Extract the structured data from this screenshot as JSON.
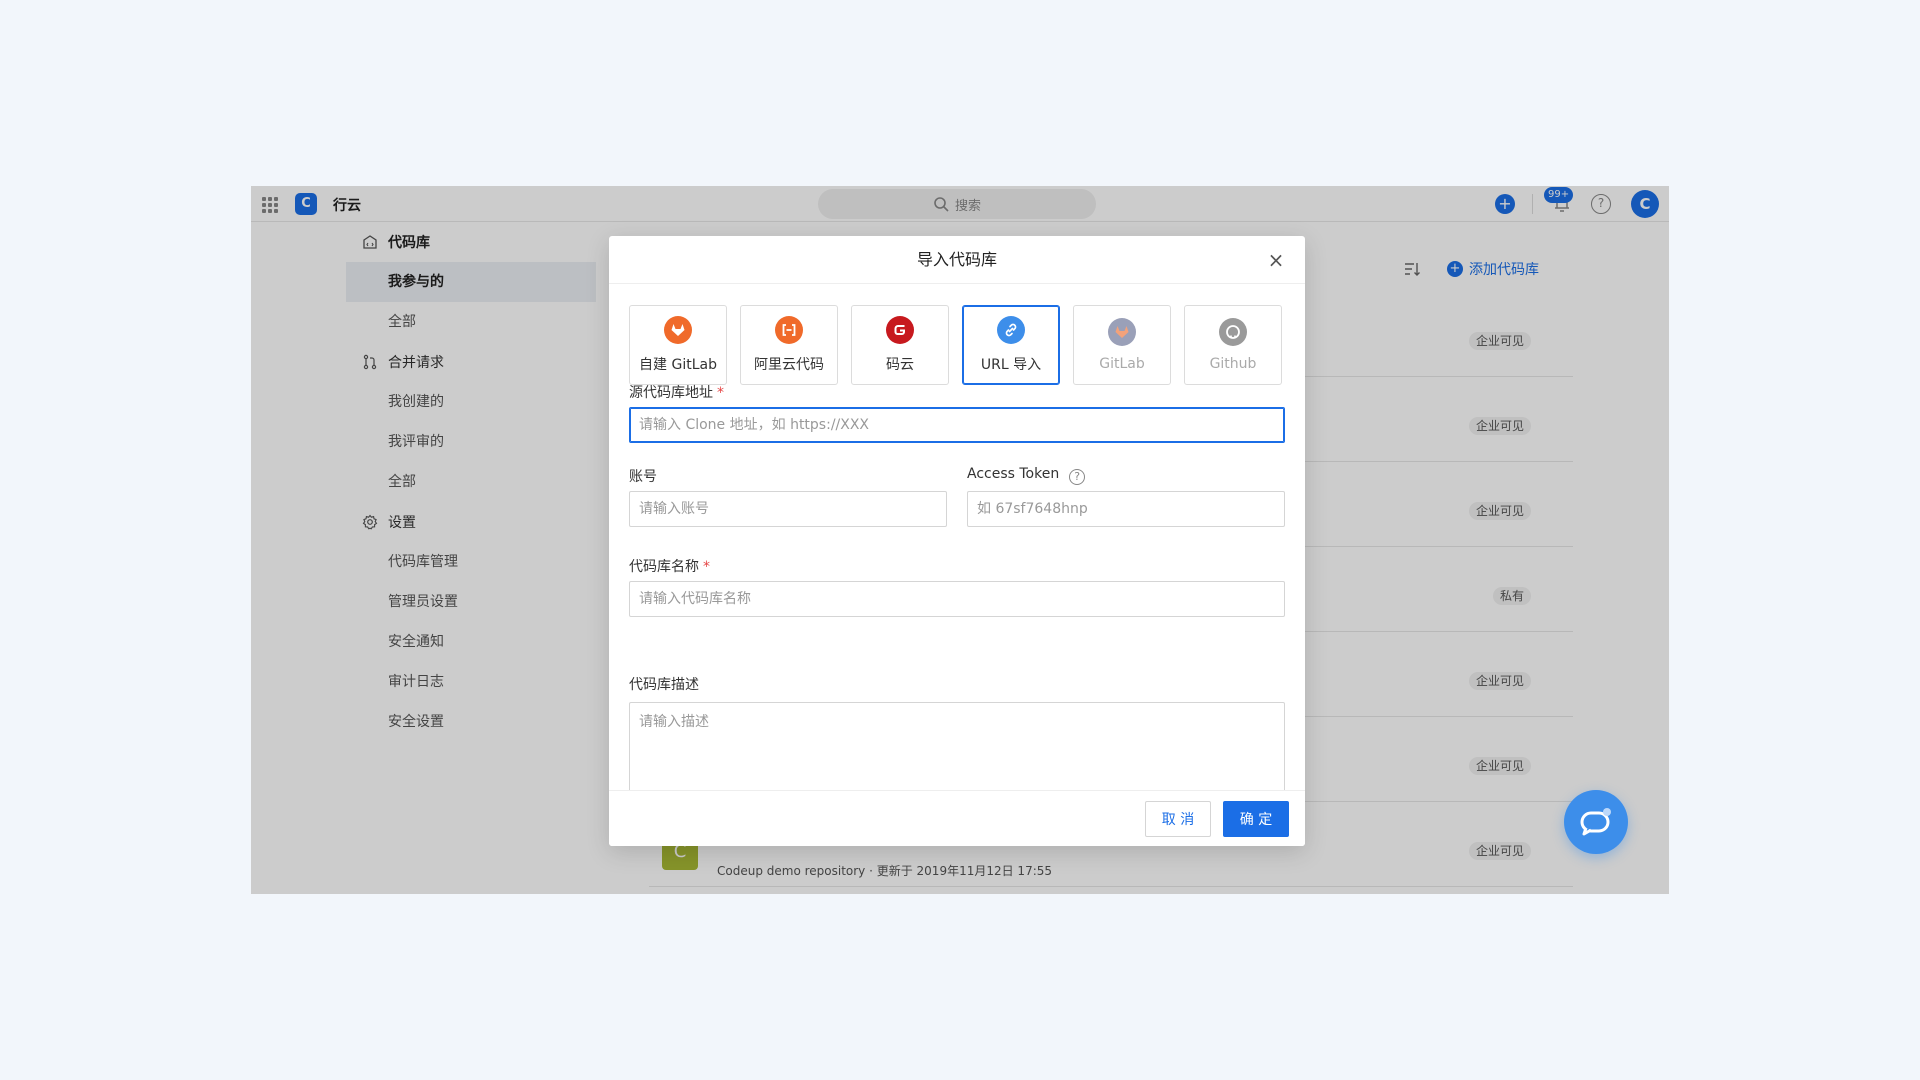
{
  "app": {
    "name": "行云",
    "logo_letter": "C",
    "avatar_letter": "C"
  },
  "search": {
    "placeholder": "搜索"
  },
  "notifications": {
    "count": "99+"
  },
  "sidebar": {
    "groups": [
      {
        "label": "代码库",
        "icon": "repo-icon",
        "items": [
          {
            "label": "我参与的",
            "active": true
          },
          {
            "label": "全部"
          }
        ]
      },
      {
        "label": "合并请求",
        "icon": "merge-request-icon",
        "items": [
          {
            "label": "我创建的"
          },
          {
            "label": "我评审的"
          },
          {
            "label": "全部"
          }
        ]
      },
      {
        "label": "设置",
        "icon": "gear-icon",
        "items": [
          {
            "label": "代码库管理"
          },
          {
            "label": "管理员设置"
          },
          {
            "label": "安全通知"
          },
          {
            "label": "审计日志"
          },
          {
            "label": "安全设置"
          }
        ]
      }
    ]
  },
  "main": {
    "add_repo_label": "添加代码库",
    "repos": [
      {
        "visibility": "企业可见"
      },
      {
        "visibility": "企业可见"
      },
      {
        "visibility": "企业可见"
      },
      {
        "visibility": "私有"
      },
      {
        "visibility": "企业可见"
      },
      {
        "visibility": "企业可见"
      },
      {
        "visibility": "企业可见",
        "icon_letter": "C",
        "meta": "Codeup demo repository  ·  更新于 2019年11月12日 17:55"
      }
    ]
  },
  "dialog": {
    "title": "导入代码库",
    "sources": [
      {
        "label": "自建 GitLab",
        "icon": "gitlab-fox-icon",
        "color": "#f06a2a"
      },
      {
        "label": "阿里云代码",
        "icon": "aliyun-icon",
        "color": "#f06a2a"
      },
      {
        "label": "码云",
        "icon": "gitee-icon",
        "color": "#c7191e"
      },
      {
        "label": "URL 导入",
        "icon": "link-icon",
        "color": "#3d8eea",
        "selected": true
      },
      {
        "label": "GitLab",
        "icon": "gitlab-icon",
        "color": "#9aa0b8",
        "disabled": true
      },
      {
        "label": "Github",
        "icon": "github-icon",
        "color": "#9a9a9a",
        "disabled": true
      }
    ],
    "source_url": {
      "label": "源代码库地址",
      "placeholder": "请输入 Clone 地址，如 https://XXX"
    },
    "account": {
      "label": "账号",
      "placeholder": "请输入账号"
    },
    "token": {
      "label": "Access Token",
      "placeholder": "如 67sf7648hnp"
    },
    "repo_name": {
      "label": "代码库名称",
      "placeholder": "请输入代码库名称"
    },
    "repo_desc": {
      "label": "代码库描述",
      "placeholder": "请输入描述"
    },
    "cancel_label": "取 消",
    "ok_label": "确 定"
  },
  "colors": {
    "accent": "#1b6ee6",
    "required": "#e54545"
  }
}
